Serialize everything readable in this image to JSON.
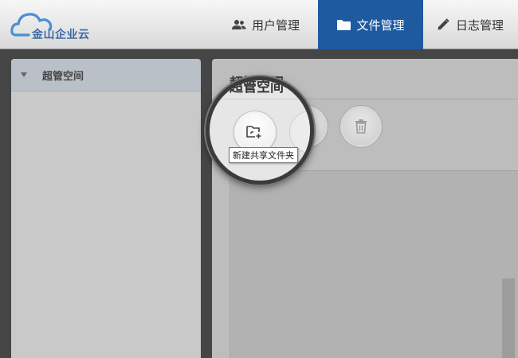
{
  "brand": {
    "name": "金山企业云",
    "logo_icon": "cloud-logo-icon"
  },
  "nav": {
    "users": {
      "label": "用户管理",
      "icon": "users-icon"
    },
    "files": {
      "label": "文件管理",
      "icon": "folder-icon",
      "active": true
    },
    "logs": {
      "label": "日志管理",
      "icon": "pencil-icon"
    }
  },
  "sidebar": {
    "header": {
      "label": "超管空间",
      "icon": "caret-down-icon"
    }
  },
  "main": {
    "title": "超管空间",
    "toolbar": {
      "new_shared_folder": {
        "icon": "folder-add-icon",
        "tooltip": "新建共享文件夹"
      },
      "share": {
        "icon": "share-icon"
      },
      "delete": {
        "icon": "trash-icon"
      }
    }
  },
  "colors": {
    "accent": "#1e5aa0",
    "header_bg": "#e8e8e8",
    "page_bg": "#454545"
  }
}
